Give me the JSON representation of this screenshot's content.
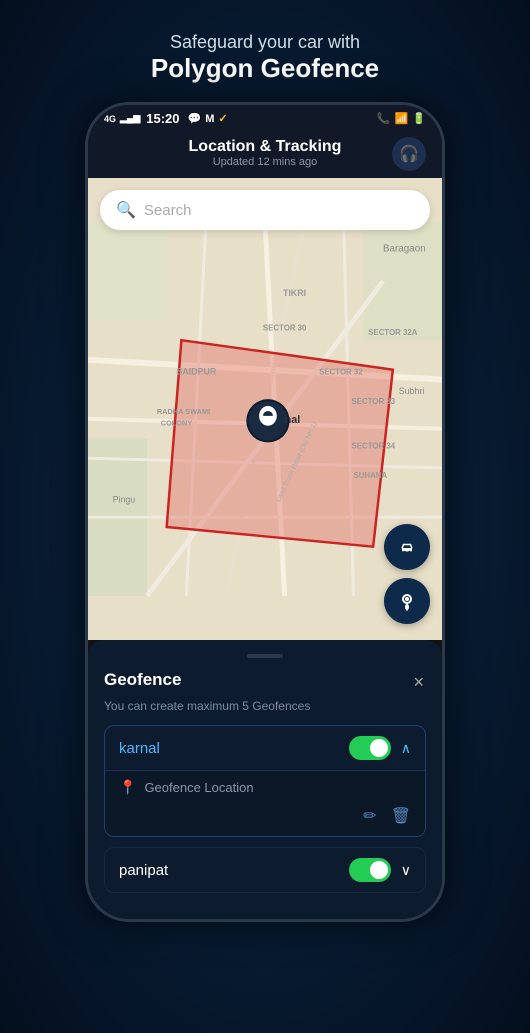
{
  "headline": {
    "subtitle": "Safeguard your car with",
    "title": "Polygon Geofence"
  },
  "status_bar": {
    "signal": "4G",
    "time": "15:20",
    "battery_icon": "🔋",
    "wifi_icon": "WiFi"
  },
  "app_header": {
    "title": "Location & Tracking",
    "subtitle": "Updated 12 mins ago",
    "headphone_icon": "🎧"
  },
  "map": {
    "search_placeholder": "Search",
    "search_icon": "🔍",
    "fab1_icon": "🚗",
    "fab2_icon": "📍",
    "location_label": "nal",
    "map_label_baragaon": "Baragaon",
    "map_label_tikri": "TIKRI",
    "map_label_sector30": "SECTOR 30",
    "map_label_sector32a": "SECTOR 32A",
    "map_label_sector32": "SECTOR 32",
    "map_label_sector33": "SECTOR 33",
    "map_label_sector34": "SECTOR 34",
    "map_label_suhana": "SUHANA",
    "map_label_saidpur": "SAIDPUR",
    "map_label_radha": "RADHA SWAMI COLONY",
    "map_label_subhri": "Subhri",
    "map_label_pingu": "Pingu"
  },
  "geofence_panel": {
    "title": "Geofence",
    "close_label": "×",
    "description": "You can create maximum 5 Geofences",
    "item1": {
      "name": "karnal",
      "enabled": true,
      "expanded": true,
      "chevron": "∧",
      "location_label": "Geofence Location",
      "edit_icon": "✏",
      "delete_icon": "🗑"
    },
    "item2": {
      "name": "panipat",
      "enabled": true,
      "expanded": false,
      "chevron": "∨"
    }
  }
}
